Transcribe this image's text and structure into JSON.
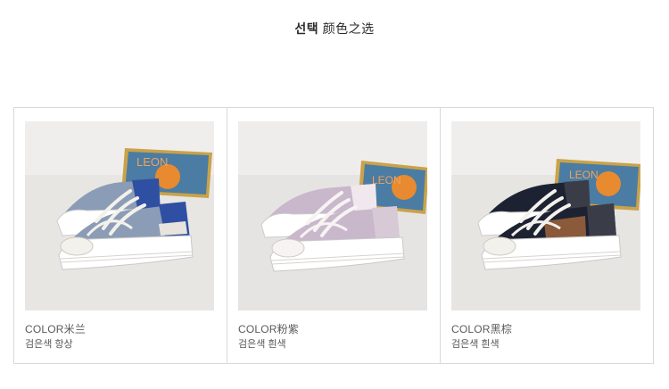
{
  "header": {
    "title_bold": "선택",
    "title_rest": "颜色之选"
  },
  "products": [
    {
      "color_label": "COLOR米兰",
      "sub_label": "검은색 항상",
      "colors": {
        "accent": "#2f4fa3",
        "panel": "#8b9cb6",
        "collar": "#e8e4dd",
        "lace": "#f3f1ec"
      },
      "book_text": "LEON"
    },
    {
      "color_label": "COLOR粉紫",
      "sub_label": "검은색 흰색",
      "colors": {
        "accent": "#d8c9d6",
        "panel": "#c9b7cc",
        "collar": "#f0e8ec",
        "lace": "#f7f3f2"
      },
      "book_text": "LEON"
    },
    {
      "color_label": "COLOR黑棕",
      "sub_label": "검은색 흰색",
      "colors": {
        "accent": "#1d2233",
        "panel": "#8a5a3b",
        "collar": "#3a3d48",
        "lace": "#f3f1ec"
      },
      "book_text": "LEON"
    }
  ]
}
